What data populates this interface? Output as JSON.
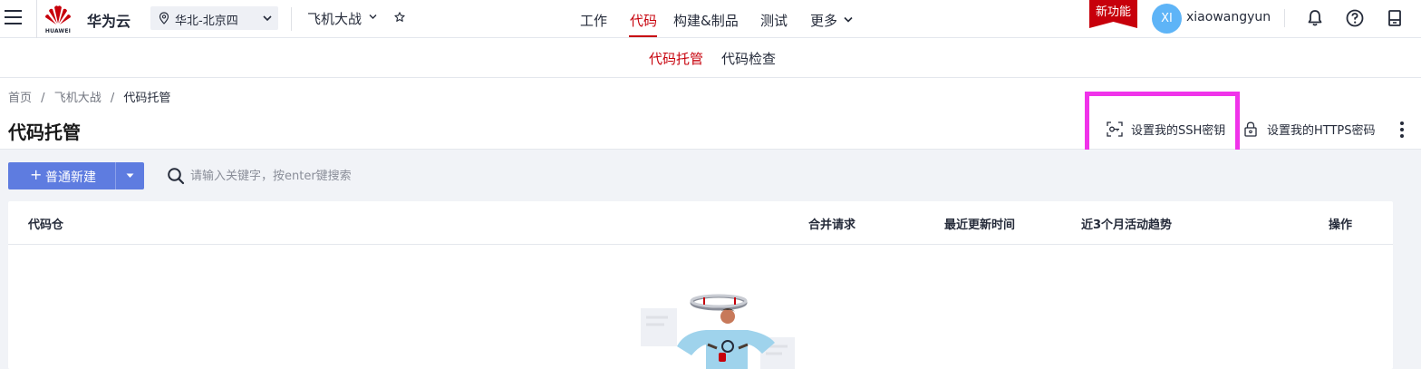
{
  "topbar": {
    "logo_text": "HUAWEI",
    "brand": "华为云",
    "region": "华北-北京四",
    "project": "飞机大战",
    "nav": [
      {
        "label": "工作",
        "active": false
      },
      {
        "label": "代码",
        "active": true
      },
      {
        "label": "构建&制品",
        "active": false
      },
      {
        "label": "测试",
        "active": false
      },
      {
        "label": "更多",
        "active": false
      }
    ],
    "new_feature": "新功能",
    "avatar_initials": "XI",
    "username": "xiaowangyun",
    "icons": [
      "menu-icon",
      "location-pin-icon",
      "star-icon",
      "bell-icon",
      "help-icon",
      "document-icon"
    ]
  },
  "subnav": {
    "items": [
      {
        "label": "代码托管",
        "active": true
      },
      {
        "label": "代码检查",
        "active": false
      }
    ]
  },
  "page": {
    "breadcrumb": [
      "首页",
      "飞机大战",
      "代码托管"
    ],
    "breadcrumb_sep": "/",
    "title": "代码托管",
    "ssh_label": "设置我的SSH密钥",
    "https_label": "设置我的HTTPS密码"
  },
  "toolbar": {
    "new_button": "普通新建",
    "search_placeholder": "请输入关键字，按enter键搜索"
  },
  "table": {
    "columns": [
      "代码仓",
      "合并请求",
      "最近更新时间",
      "近3个月活动趋势",
      "操作"
    ]
  },
  "colors": {
    "accent": "#c7000b",
    "primary_button": "#5e7ce0",
    "avatar": "#5eb4f7",
    "highlight_box": "#f033ea"
  }
}
